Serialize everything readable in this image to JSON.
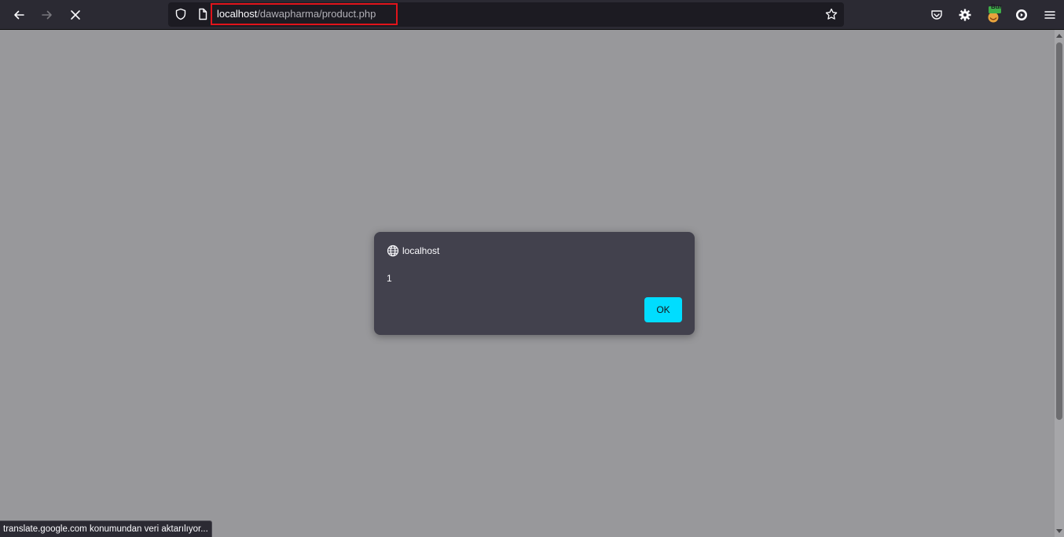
{
  "browser": {
    "url": {
      "host": "localhost",
      "path": "/dawapharma/product.php"
    },
    "buttons": {
      "back": "back-arrow-icon",
      "forward": "forward-arrow-icon",
      "stop": "close-icon"
    },
    "extensions": {
      "burp_badge": "Bur"
    }
  },
  "dialog": {
    "origin": "localhost",
    "message": "1",
    "ok_label": "OK"
  },
  "status_bar": {
    "text": "translate.google.com konumundan veri aktarılıyor..."
  },
  "colors": {
    "toolbar": "#2b2a33",
    "urlbar": "#1c1b22",
    "highlight": "#e0141b",
    "dialog_bg": "#42414d",
    "ok_button": "#00ddff",
    "page_overlay": "#98989b"
  }
}
